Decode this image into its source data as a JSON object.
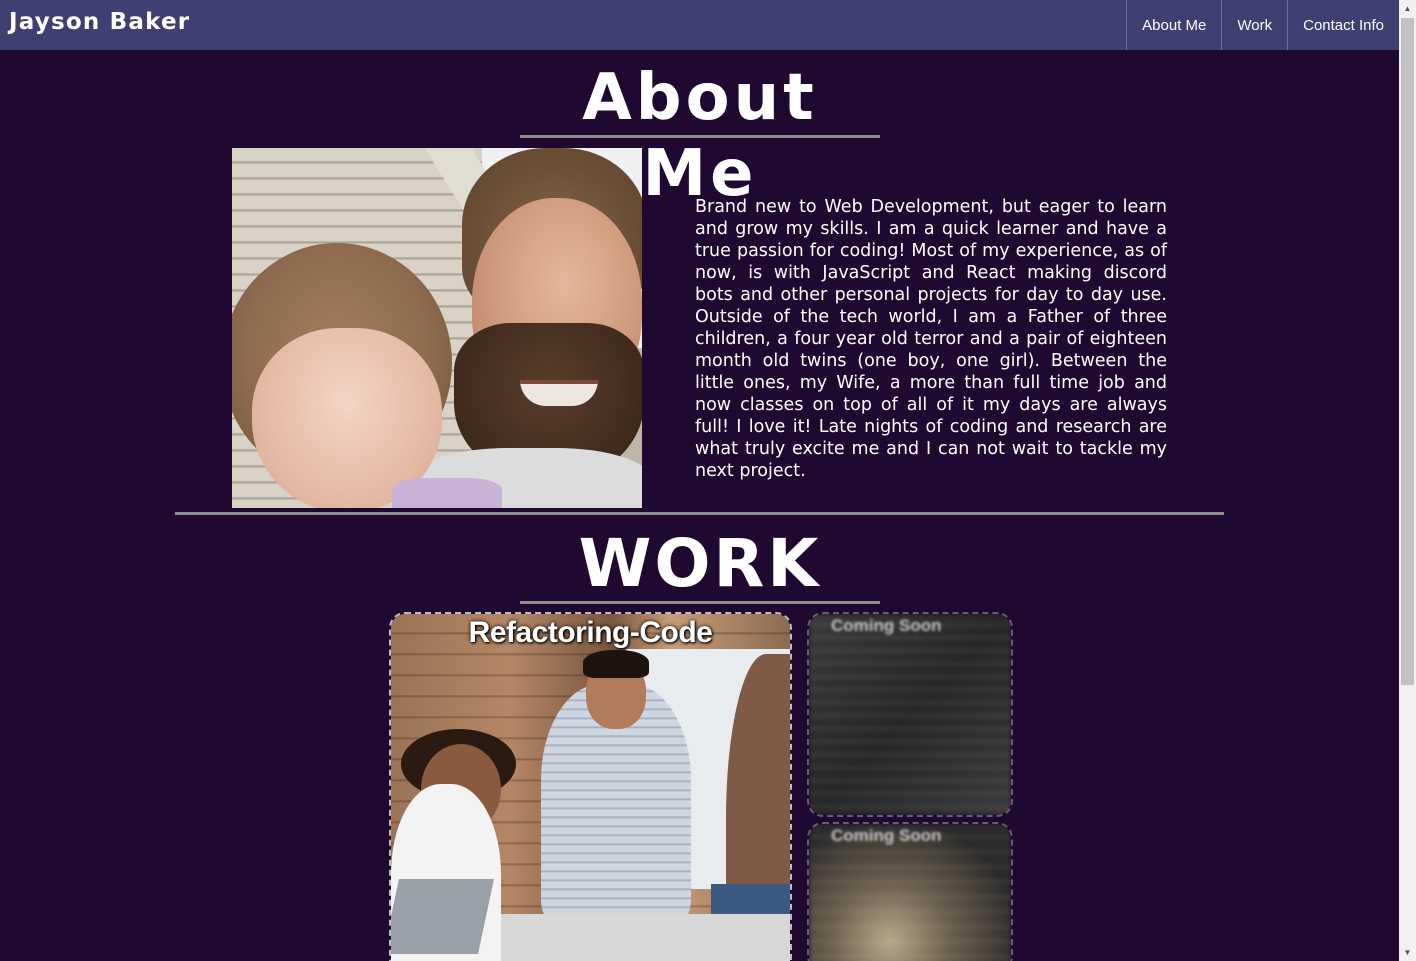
{
  "header": {
    "brand": "Jayson Baker",
    "nav": [
      {
        "label": "About Me"
      },
      {
        "label": "Work"
      },
      {
        "label": "Contact Info"
      }
    ]
  },
  "about": {
    "title": "About Me",
    "photo_icon": "profile-photo",
    "text": "Brand new to Web Development, but eager to learn and grow my skills. I am a quick learner and have a true passion for coding! Most of my experience, as of now, is with JavaScript and React making discord bots and other personal projects for day to day use. Outside of the tech world, I am a Father of three children, a four year old terror and a pair of eighteen month old twins (one boy, one girl). Between the little ones, my Wife, a more than full time job and now classes on top of all of it my days are always full! I love it! Late nights of coding and research are what truly excite me and I can not wait to tackle my next project."
  },
  "work": {
    "title": "WORK",
    "projects": [
      {
        "title": "Refactoring-Code"
      },
      {
        "title": "Coming Soon"
      },
      {
        "title": "Coming Soon"
      }
    ]
  },
  "colors": {
    "background": "#1f0930",
    "header": "#3f3f72",
    "divider": "#8e8e8e",
    "text": "#ffffff"
  }
}
